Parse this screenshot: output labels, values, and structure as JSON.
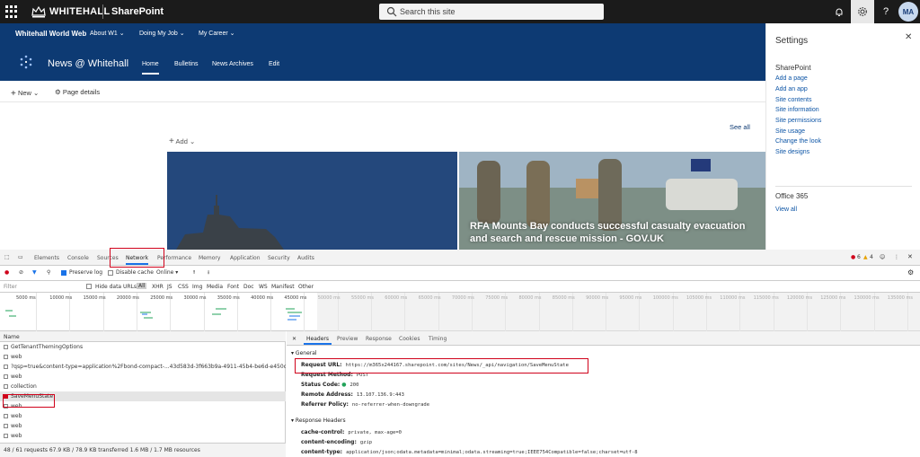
{
  "suitebar": {
    "brand": "WHITEHALL",
    "app": "SharePoint",
    "search_placeholder": "Search this site",
    "avatar_initials": "MA",
    "help": "?"
  },
  "hub": {
    "name": "Whitehall World Web",
    "nav": [
      "About W1",
      "Doing My Job",
      "My Career"
    ]
  },
  "site": {
    "title": "News @ Whitehall",
    "nav": [
      "Home",
      "Bulletins",
      "News Archives",
      "Edit"
    ],
    "active_nav": "Home"
  },
  "commandbar": {
    "new_label": "New",
    "page_details_label": "Page details"
  },
  "content": {
    "add_label": "Add",
    "see_all": "See all",
    "hero_caption": "RFA Mounts Bay conducts successful casualty evacuation and search and rescue mission - GOV.UK"
  },
  "settings": {
    "title": "Settings",
    "sharepoint_heading": "SharePoint",
    "links": [
      "Add a page",
      "Add an app",
      "Site contents",
      "Site information",
      "Site permissions",
      "Site usage",
      "Change the look",
      "Site designs"
    ],
    "office_heading": "Office 365",
    "view_all": "View all"
  },
  "devtools": {
    "tabs": [
      "Elements",
      "Console",
      "Sources",
      "Network",
      "Performance",
      "Memory",
      "Application",
      "Security",
      "Audits"
    ],
    "active_tab": "Network",
    "error_count": "6",
    "warning_count": "4",
    "toolbar": {
      "preserve_log": "Preserve log",
      "disable_cache": "Disable cache",
      "throttle": "Online"
    },
    "filter": {
      "placeholder": "Filter",
      "hide_data_urls": "Hide data URLs",
      "types": [
        "All",
        "XHR",
        "JS",
        "CSS",
        "Img",
        "Media",
        "Font",
        "Doc",
        "WS",
        "Manifest",
        "Other"
      ]
    },
    "timeline_ticks": [
      "5000 ms",
      "10000 ms",
      "15000 ms",
      "20000 ms",
      "25000 ms",
      "30000 ms",
      "35000 ms",
      "40000 ms",
      "45000 ms",
      "50000 ms",
      "55000 ms",
      "60000 ms",
      "65000 ms",
      "70000 ms",
      "75000 ms",
      "80000 ms",
      "85000 ms",
      "90000 ms",
      "95000 ms",
      "100000 ms",
      "105000 ms",
      "110000 ms",
      "115000 ms",
      "120000 ms",
      "125000 ms",
      "130000 ms",
      "135000 ms"
    ],
    "list_header": "Name",
    "requests": [
      "GetTenantThemingOptions",
      "web",
      "?qsp=true&content-type=application%2Fbond-compact-...43d583d-3f663b9a-4911-45b4-be6d-e450ca91.",
      "web",
      "collection",
      "SaveMenuState",
      "web",
      "web",
      "web",
      "web"
    ],
    "selected_request": "SaveMenuState",
    "detail_tabs": [
      "Headers",
      "Preview",
      "Response",
      "Cookies",
      "Timing"
    ],
    "active_detail_tab": "Headers",
    "general_heading": "General",
    "general": [
      {
        "key": "Request URL:",
        "value": "https://m365x244167.sharepoint.com/sites/News/_api/navigation/SaveMenuState"
      },
      {
        "key": "Request Method:",
        "value": "POST"
      },
      {
        "key": "Status Code:",
        "value": "200"
      },
      {
        "key": "Remote Address:",
        "value": "13.107.136.9:443"
      },
      {
        "key": "Referrer Policy:",
        "value": "no-referrer-when-downgrade"
      }
    ],
    "response_heading": "Response Headers",
    "response": [
      {
        "key": "cache-control:",
        "value": "private, max-age=0"
      },
      {
        "key": "content-encoding:",
        "value": "gzip"
      },
      {
        "key": "content-type:",
        "value": "application/json;odata.metadata=minimal;odata.streaming=true;IEEE754Compatible=false;charset=utf-8"
      }
    ],
    "status_bar": "48 / 61 requests  67.9 KB / 78.9 KB transferred  1.6 MB / 1.7 MB resources"
  }
}
